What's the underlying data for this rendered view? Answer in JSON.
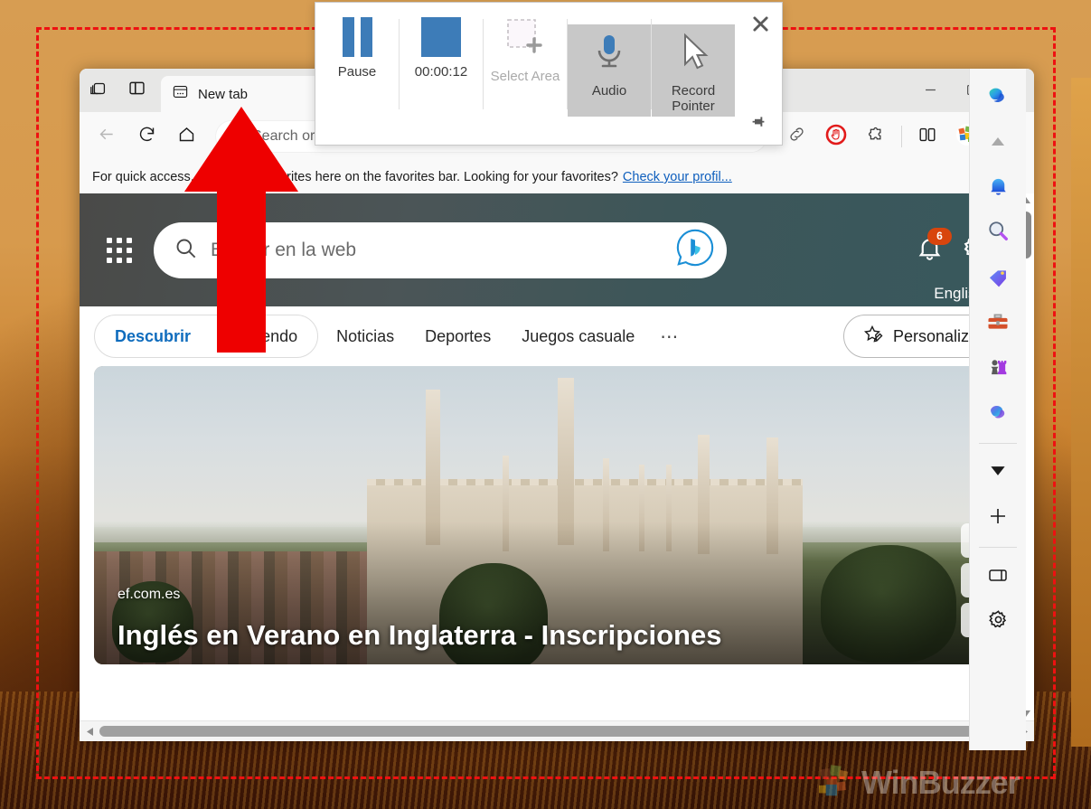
{
  "recorder": {
    "pause": {
      "label": "Pause",
      "icon": "pause-icon"
    },
    "timer": {
      "label": "00:00:12",
      "icon": "stop-record-icon"
    },
    "select_area": {
      "label": "Select Area",
      "icon": "select-area-icon",
      "enabled": false
    },
    "audio": {
      "label": "Audio",
      "icon": "microphone-icon",
      "active": true
    },
    "record_pointer": {
      "label": "Record Pointer",
      "icon": "mouse-pointer-icon",
      "active": true
    },
    "close_icon": "close-icon",
    "pin_icon": "pin-icon",
    "accent_color": "#3d7cb8",
    "toggled_bg": "#c8c8c8"
  },
  "browser": {
    "tabstrip": {
      "workspaces_icon": "workspaces-icon",
      "tab_actions_icon": "tab-actions-menu-icon",
      "tab_favicon": "new-tab-favicon",
      "tab_label": "New tab",
      "minimize_label": "—",
      "maximize_icon": "maximize-icon",
      "close_icon": "close-icon"
    },
    "navbar": {
      "back_icon": "back-arrow-icon",
      "refresh_icon": "refresh-icon",
      "home_icon": "home-icon",
      "search_icon": "search-icon",
      "address_placeholder": "Search or ",
      "read_aloud_icon": "read-aloud-icon",
      "favorite_icon": "star-favorite-icon",
      "link_icon": "copy-link-icon",
      "adblock_icon": "adblock-icon",
      "extension_icon": "extension-puzzle-icon",
      "split_screen_icon": "split-screen-icon",
      "collections_icon": "collections-cubes-icon",
      "settings_menu_icon": "settings-more-icon",
      "copilot_icon": "copilot-icon"
    },
    "favorites_bar": {
      "text": "For quick access, place your favorites here on the favorites bar. Looking for your favorites?",
      "link_text": "Check your profil...",
      "link_color": "#0f5fbd"
    }
  },
  "newtab": {
    "hero": {
      "waffle_icon": "app-launcher-waffle-icon",
      "search_icon": "search-icon",
      "search_placeholder": "Buscar en la web",
      "bing_chat_icon": "bing-copilot-icon",
      "bell_icon": "notifications-bell-icon",
      "bell_badge": "6",
      "badge_color": "#d8450d",
      "gear_icon": "settings-gear-icon",
      "language_label": "English"
    },
    "feed_tabs": {
      "pill": [
        {
          "label": "Descubrir",
          "active": true
        },
        {
          "label": "Siguiendo",
          "active": false
        }
      ],
      "links": [
        "Noticias",
        "Deportes",
        "Juegos casuale"
      ],
      "more_label": "⋯",
      "personalize": {
        "label": "Personalizar",
        "icon": "star-pencil-icon"
      },
      "active_color": "#0f6cbd"
    },
    "article": {
      "source": "ef.com.es",
      "title": "Inglés en Verano en Inglaterra - Inscripciones",
      "actions": [
        {
          "icon": "play-video-icon"
        },
        {
          "icon": "expand-arrows-icon"
        },
        {
          "icon": "feedback-comment-icon"
        }
      ]
    },
    "scrollbar": {
      "up_icon": "scroll-up-arrow-icon",
      "down_icon": "scroll-down-arrow-icon",
      "left_icon": "scroll-left-arrow-icon",
      "right_icon": "scroll-right-arrow-icon"
    }
  },
  "edge_sidebar": {
    "items": [
      {
        "name": "copilot",
        "icon": "copilot-icon"
      },
      {
        "name": "collapse",
        "icon": "chevron-up-icon"
      },
      {
        "name": "notifications",
        "icon": "bell-icon"
      },
      {
        "name": "search",
        "icon": "magnifier-icon"
      },
      {
        "name": "shopping",
        "icon": "shopping-tag-icon"
      },
      {
        "name": "tools",
        "icon": "toolbox-icon"
      },
      {
        "name": "games",
        "icon": "chess-games-icon"
      },
      {
        "name": "microsoft365",
        "icon": "microsoft-365-icon"
      },
      {
        "name": "expand",
        "icon": "chevron-down-icon"
      },
      {
        "name": "add",
        "icon": "plus-icon"
      },
      {
        "name": "split",
        "icon": "sidebar-panel-icon"
      },
      {
        "name": "settings",
        "icon": "gear-icon"
      }
    ]
  },
  "overlay": {
    "capture_border_color": "#ee1111",
    "arrow_color": "#ee0000",
    "watermark_text": "WinBuzzer"
  }
}
